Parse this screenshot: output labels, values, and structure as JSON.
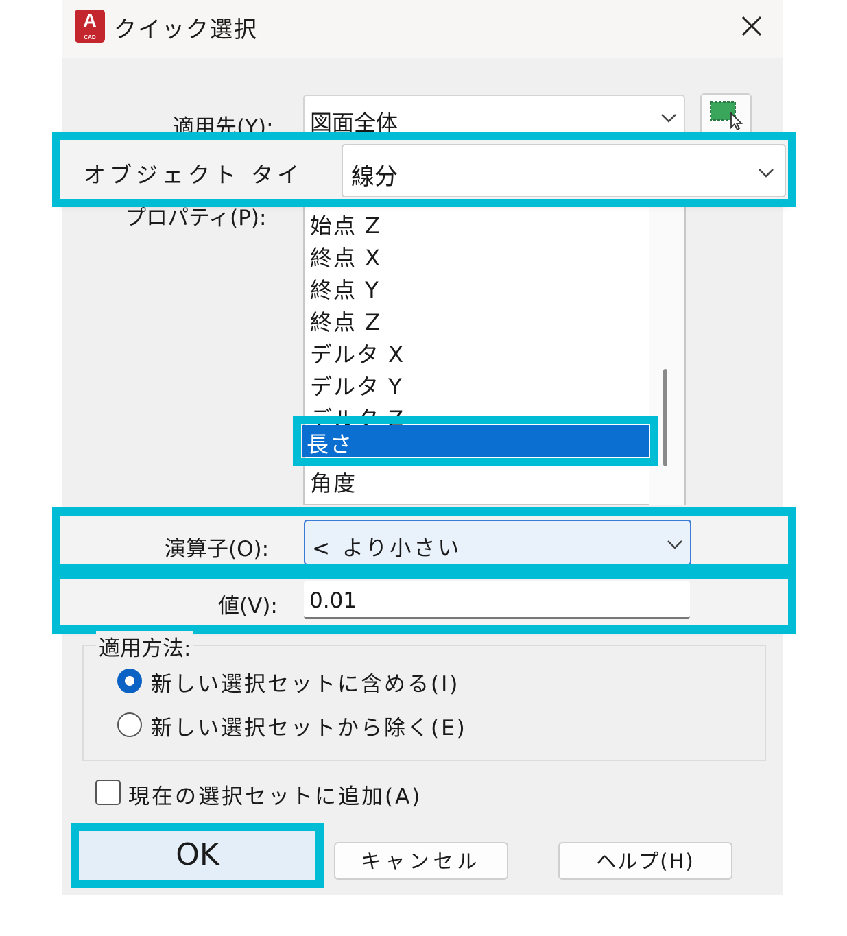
{
  "window": {
    "title": "クイック選択",
    "app_icon_letter": "A",
    "app_icon_sub": "CAD"
  },
  "fields": {
    "apply_to_label": "適用先(Y):",
    "apply_to_value": "図面全体",
    "object_type_label": "オブジェクト タイ",
    "object_type_value": "線分",
    "properties_label": "プロパティ(P):",
    "properties": [
      "始点 Z",
      "終点 X",
      "終点 Y",
      "終点 Z",
      "デルタ X",
      "デルタ Y",
      "デルタ Z",
      "長さ",
      "角度"
    ],
    "selected_property": "長さ",
    "operator_label": "演算子(O):",
    "operator_value": "< より小さい",
    "value_label": "値(V):",
    "value_value": "0.01"
  },
  "apply_method": {
    "label": "適用方法:",
    "include_label": "新しい選択セットに含める(I)",
    "exclude_label": "新しい選択セットから除く(E)",
    "selected": "include"
  },
  "append_checkbox": {
    "label": "現在の選択セットに追加(A)",
    "checked": false
  },
  "buttons": {
    "ok": "OK",
    "cancel": "キャンセル",
    "help": "ヘルプ(H)"
  },
  "colors": {
    "highlight": "#00bcd4",
    "selection": "#0a6fd1",
    "app_icon": "#c4262e",
    "pick_icon": "#3aa65c"
  }
}
